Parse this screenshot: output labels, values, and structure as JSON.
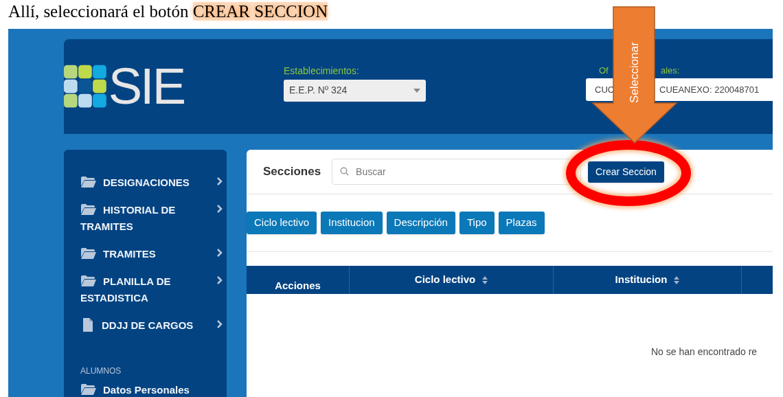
{
  "instruction": {
    "lead": "Allí, seleccionará el botón ",
    "highlight": "CREAR SECCION"
  },
  "header": {
    "logo_text": "SIE",
    "establecimientos": {
      "label": "Establecimientos:",
      "value": "E.E.P. Nº 324"
    },
    "oficinas": {
      "label_parts": [
        "Of",
        "ales:"
      ],
      "value_parts": [
        "CUC",
        "CUEANEXO: 220048701"
      ]
    }
  },
  "sidebar": {
    "sections": [
      {
        "items": [
          {
            "label": "DESIGNACIONES",
            "kind": "folder",
            "expandable": true
          },
          {
            "label": "HISTORIAL DE TRAMITES",
            "kind": "folder",
            "expandable": true
          },
          {
            "label": "TRAMITES",
            "kind": "folder",
            "expandable": true
          },
          {
            "label": "PLANILLA DE ESTADISTICA",
            "kind": "folder",
            "expandable": true
          },
          {
            "label": "DDJJ DE CARGOS",
            "kind": "file",
            "expandable": true
          }
        ]
      },
      {
        "heading": "ALUMNOS",
        "items": [
          {
            "label": "Datos Personales",
            "kind": "folder",
            "expandable": false
          }
        ]
      }
    ]
  },
  "main": {
    "title": "Secciones",
    "search": {
      "placeholder": "Buscar"
    },
    "create_button": "Crear Seccion",
    "column_toggles": [
      "Ciclo lectivo",
      "Institucion",
      "Descripción",
      "Tipo",
      "Plazas"
    ],
    "table": {
      "columns": [
        {
          "label": "Acciones",
          "sortable": false
        },
        {
          "label": "Ciclo lectivo",
          "sortable": true
        },
        {
          "label": "Institucion",
          "sortable": true
        }
      ],
      "empty_message": "No se han encontrado re"
    }
  },
  "annotation": {
    "arrow_label": "Seleccionar"
  }
}
